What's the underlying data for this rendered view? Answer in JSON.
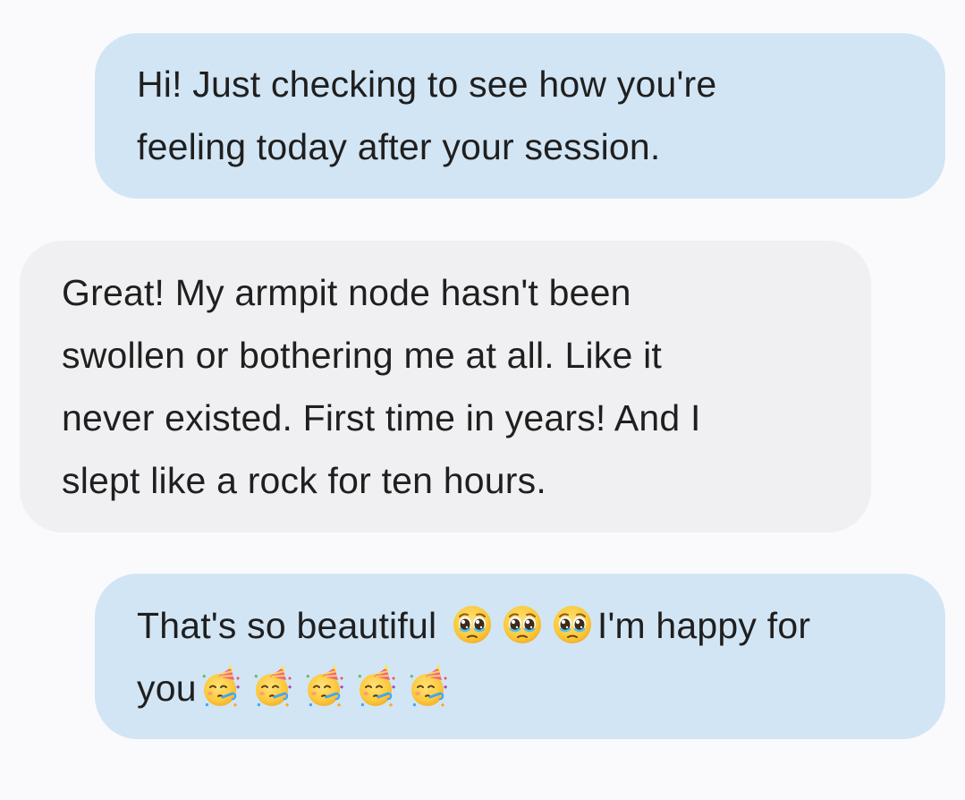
{
  "messages": [
    {
      "direction": "outgoing",
      "lines": [
        "Hi! Just checking to see how you're",
        "feeling today after your session."
      ]
    },
    {
      "direction": "incoming",
      "lines": [
        "Great! My armpit node hasn't been",
        "swollen or bothering me at all. Like it",
        "never existed. First time in years! And I",
        "slept like a rock for ten hours."
      ]
    },
    {
      "direction": "outgoing",
      "line1_before_emoji": "That's so beautiful",
      "line1_after_emoji": "I'm happy for",
      "line2_text": "you",
      "emoji_line1": [
        "pleading-face-icon",
        "pleading-face-icon",
        "pleading-face-icon"
      ],
      "emoji_line2": [
        "partying-face-icon",
        "partying-face-icon",
        "partying-face-icon",
        "partying-face-icon",
        "partying-face-icon"
      ]
    }
  ],
  "colors": {
    "background": "#fafafd",
    "outgoing_bubble": "#d2e5f4",
    "incoming_bubble": "#f0f0f2",
    "text": "#1f1f1f"
  }
}
